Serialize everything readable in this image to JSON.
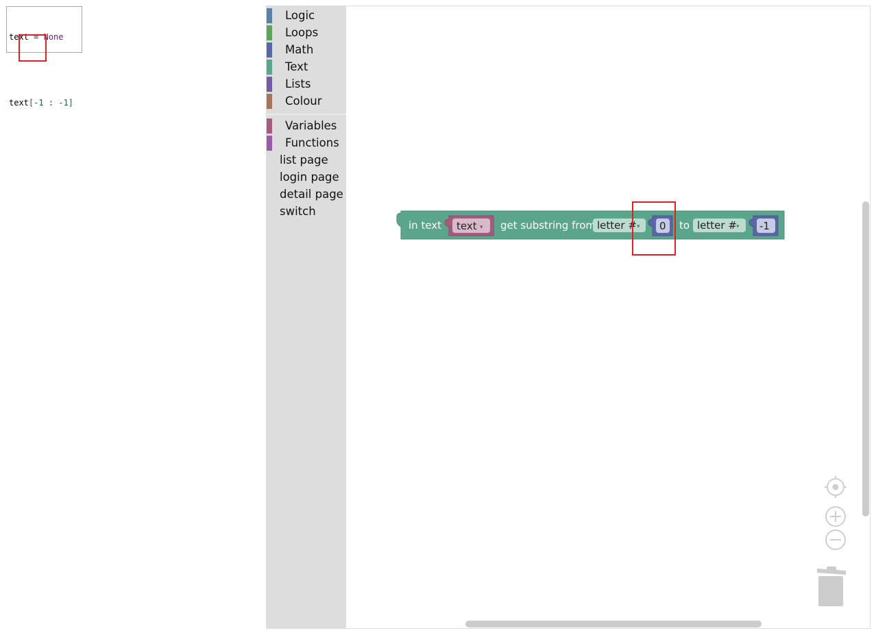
{
  "code": {
    "line1": {
      "var": "text",
      "op": " = ",
      "value": "None"
    },
    "line2": {
      "var": "text",
      "open": "[",
      "start": "-1",
      "sep": " : ",
      "end": "-1",
      "close": "]"
    }
  },
  "toolbox": {
    "categories": [
      {
        "label": "Logic",
        "color": "#5b80a5"
      },
      {
        "label": "Loops",
        "color": "#5ba55b"
      },
      {
        "label": "Math",
        "color": "#5b67a5"
      },
      {
        "label": "Text",
        "color": "#5ba58c"
      },
      {
        "label": "Lists",
        "color": "#745ba5"
      },
      {
        "label": "Colour",
        "color": "#a5745b"
      }
    ],
    "dynamic": [
      {
        "label": "Variables",
        "color": "#a55b80"
      },
      {
        "label": "Functions",
        "color": "#995ba5"
      }
    ],
    "pages": [
      "list page",
      "login page",
      "detail page",
      "switch"
    ]
  },
  "block": {
    "label_in_text": "in text",
    "var_name": "text",
    "label_get_substring": "get substring from",
    "from_mode": "letter #",
    "from_value": "0",
    "label_to": "to",
    "to_mode": "letter #",
    "to_value": "-1",
    "dropdown_arrow": "▾",
    "colors": {
      "text_block": "#5ba58c",
      "variable_block": "#a55b80",
      "math_block": "#5b67a5"
    }
  },
  "controls": {
    "icons": [
      "recenter-icon",
      "zoom-in-icon",
      "zoom-out-icon",
      "trash-icon"
    ]
  }
}
